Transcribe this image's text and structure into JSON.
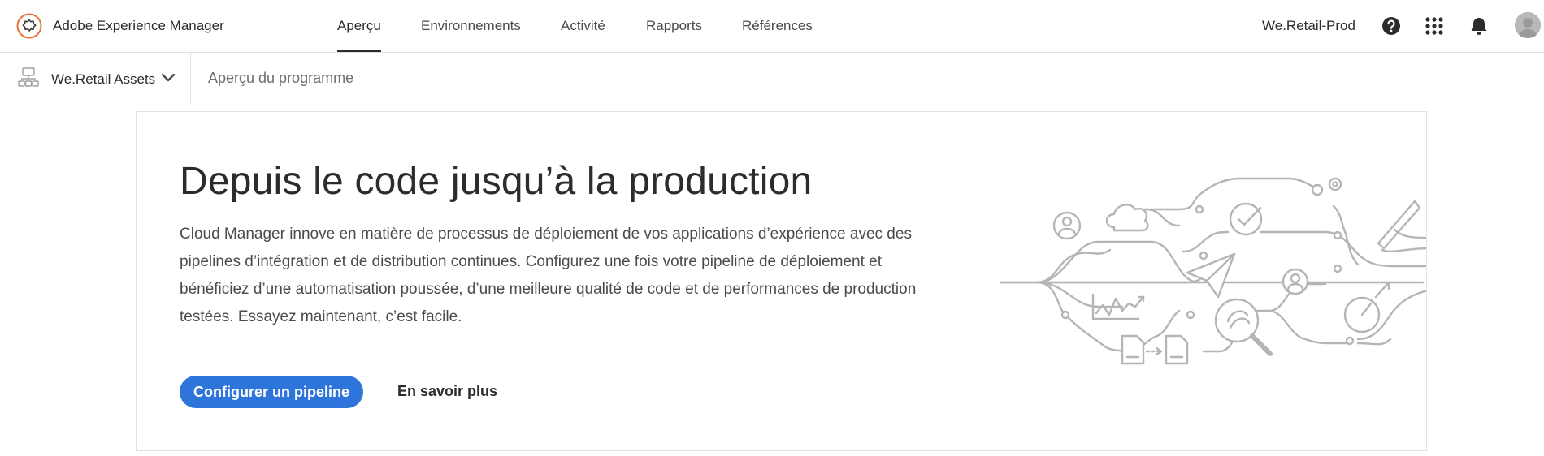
{
  "header": {
    "app_title": "Adobe Experience Manager",
    "nav": [
      {
        "label": "Aperçu",
        "active": true
      },
      {
        "label": "Environnements",
        "active": false
      },
      {
        "label": "Activité",
        "active": false
      },
      {
        "label": "Rapports",
        "active": false
      },
      {
        "label": "Références",
        "active": false
      }
    ],
    "program_name": "We.Retail-Prod",
    "icons": [
      "adobe-logo-icon",
      "help-icon",
      "apps-grid-icon",
      "bell-icon",
      "avatar"
    ]
  },
  "subheader": {
    "program_switcher_label": "We.Retail Assets",
    "page_title": "Aperçu du programme",
    "icons": [
      "program-icon",
      "chevron-down-icon"
    ]
  },
  "card": {
    "title": "Depuis le code jusqu’à la production",
    "description": "Cloud Manager innove en matière de processus de déploiement de vos applications d’expérience avec des pipelines d’intégration et de distribution continues. Configurez une fois votre pipeline de déploiement et bénéficiez d’une automatisation poussée, d’une meilleure qualité de code et de performances de production testées. Essayez maintenant, c’est facile.",
    "primary_button": "Configurer un pipeline",
    "secondary_link": "En savoir plus",
    "illustration": "pipeline-illustration"
  },
  "colors": {
    "accent": "#2d74db",
    "logo": "#e8743b",
    "border": "#e1e1e1",
    "illustration_stroke": "#b5b5b5"
  }
}
